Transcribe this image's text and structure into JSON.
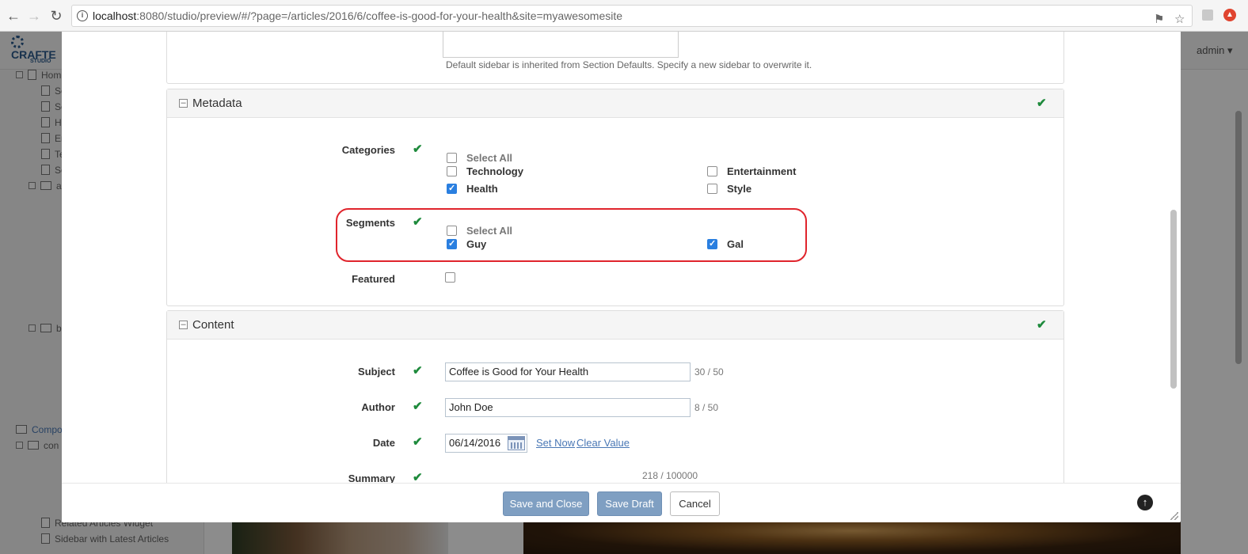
{
  "browser": {
    "url_host": "localhost",
    "url_rest": ":8080/studio/preview/#/?page=/articles/2016/6/coffee-is-good-for-your-health&site=myawesomesite"
  },
  "app": {
    "logo_text": "CRAFTE",
    "logo_sub": "STUDIO",
    "user_menu": "admin",
    "sidebar_items": [
      "Hom",
      "Se",
      "Se",
      "H",
      "Er",
      "Te",
      "Se",
      "ar",
      "bl",
      "Compo",
      "con",
      "",
      "",
      "",
      "Related Articles Widget",
      "Sidebar with Latest Articles"
    ]
  },
  "modal": {
    "sidebar_help": "Default sidebar is inherited from Section Defaults. Specify a new sidebar to overwrite it.",
    "metadata": {
      "title": "Metadata",
      "categories_label": "Categories",
      "select_all": "Select All",
      "categories": [
        {
          "label": "Technology",
          "checked": false
        },
        {
          "label": "Entertainment",
          "checked": false
        },
        {
          "label": "Health",
          "checked": true
        },
        {
          "label": "Style",
          "checked": false
        }
      ],
      "segments_label": "Segments",
      "segments": [
        {
          "label": "Guy",
          "checked": true
        },
        {
          "label": "Gal",
          "checked": true
        }
      ],
      "featured_label": "Featured",
      "featured_checked": false
    },
    "content": {
      "title": "Content",
      "subject_label": "Subject",
      "subject_value": "Coffee is Good for Your Health",
      "subject_count": "30 / 50",
      "author_label": "Author",
      "author_value": "John Doe",
      "author_count": "8 / 50",
      "date_label": "Date",
      "date_value": "06/14/2016",
      "set_now": "Set Now",
      "clear_value": "Clear Value",
      "summary_label": "Summary",
      "summary_count": "218 / 100000"
    },
    "footer": {
      "save_close": "Save and Close",
      "save_draft": "Save Draft",
      "cancel": "Cancel"
    }
  },
  "colors": {
    "check_green": "#1e8a3c",
    "highlight_red": "#e0242c",
    "primary_button": "#7f9fc2",
    "link_blue": "#4a78b5",
    "checkbox_blue": "#2a7fe0"
  }
}
